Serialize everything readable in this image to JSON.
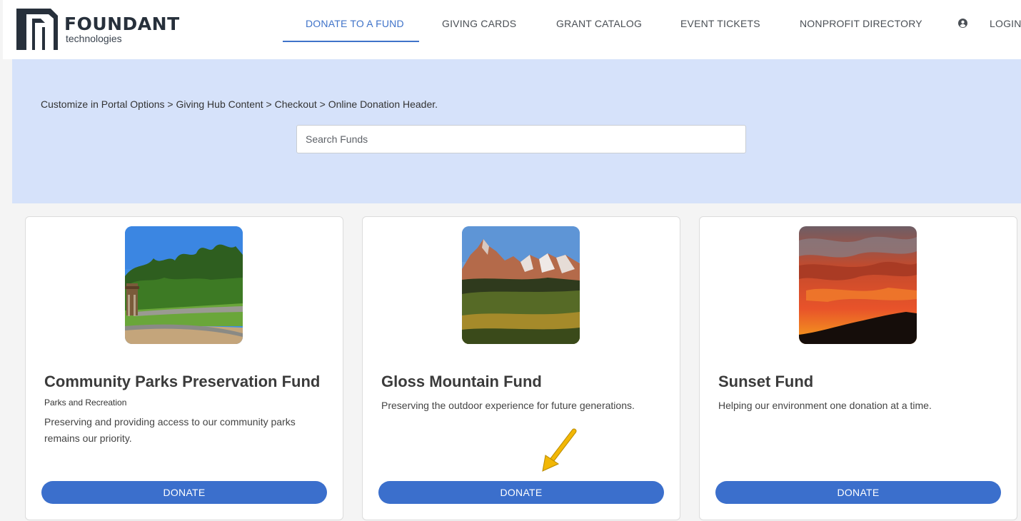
{
  "brand": {
    "name": "FOUNDANT",
    "sub": "technologies"
  },
  "nav": {
    "items": [
      {
        "label": "DONATE TO A FUND",
        "active": true
      },
      {
        "label": "GIVING CARDS"
      },
      {
        "label": "GRANT CATALOG"
      },
      {
        "label": "EVENT TICKETS"
      },
      {
        "label": "NONPROFIT DIRECTORY"
      }
    ],
    "login": {
      "label": "LOGIN",
      "icon": "user-circle-icon"
    }
  },
  "hero": {
    "text": "Customize in Portal Options > Giving Hub Content > Checkout > Online Donation Header.",
    "search_placeholder": "Search Funds"
  },
  "funds": [
    {
      "title": "Community Parks Preservation Fund",
      "category": "Parks and Recreation",
      "description": "Preserving and providing access to our community parks remains our priority.",
      "image": "park-image",
      "button": "DONATE"
    },
    {
      "title": "Gloss Mountain Fund",
      "category": "",
      "description": "Preserving the outdoor experience for future generations.",
      "image": "mountain-image",
      "button": "DONATE"
    },
    {
      "title": "Sunset Fund",
      "category": "",
      "description": "Helping our environment one donation at a time.",
      "image": "sunset-image",
      "button": "DONATE"
    }
  ],
  "colors": {
    "accent": "#3b6fcc",
    "hero_bg": "#d6e2fa",
    "arrow": "#f2b705"
  }
}
